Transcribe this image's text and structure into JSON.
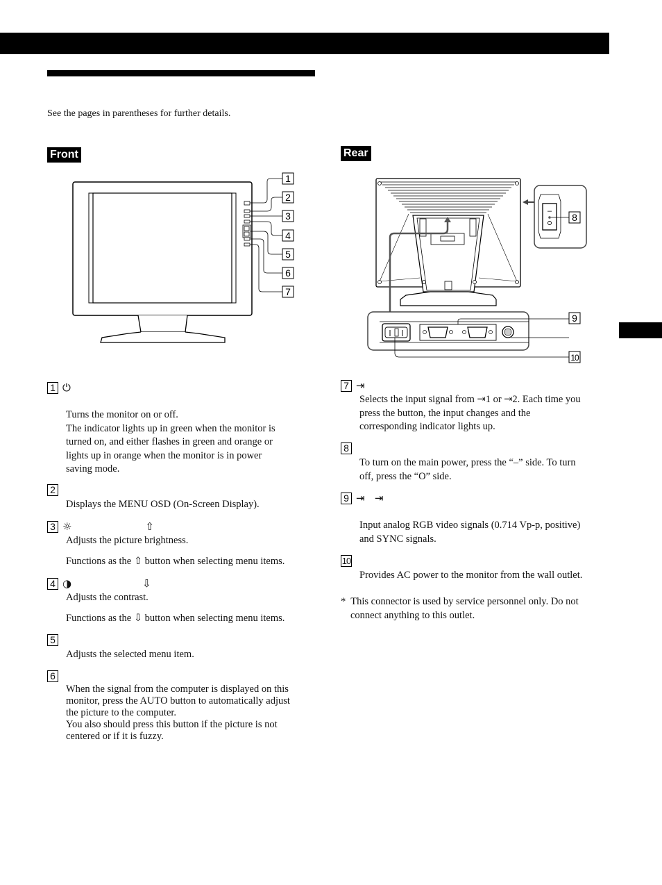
{
  "page": {
    "intro": "See the pages in parentheses for further details.",
    "front_label": "Front",
    "rear_label": "Rear"
  },
  "front_callouts": [
    "1",
    "2",
    "3",
    "4",
    "5",
    "6",
    "7"
  ],
  "rear_callouts": [
    "8",
    "9",
    "10"
  ],
  "switch_marks": {
    "on": "–",
    "off": "O"
  },
  "front_items": [
    {
      "num": "1",
      "icon": "power-icon",
      "glyph": "⏻",
      "arrow": "",
      "text": [
        "Turns the monitor on or off.",
        "The indicator lights up in green when the monitor is",
        "turned on, and either flashes in green and orange or",
        "lights up in orange when the monitor is in power",
        "saving mode."
      ]
    },
    {
      "num": "2",
      "icon": "",
      "glyph": "",
      "arrow": "",
      "text": [
        "Displays the MENU OSD (On-Screen Display)."
      ]
    },
    {
      "num": "3",
      "icon": "brightness-icon",
      "glyph": "☼",
      "arrow": "⇧",
      "text": [
        "Adjusts the picture brightness."
      ],
      "note": "Functions as the ⇧ button when selecting menu items."
    },
    {
      "num": "4",
      "icon": "contrast-icon",
      "glyph": "◑",
      "arrow": "⇩",
      "text": [
        "Adjusts the contrast."
      ],
      "note": "Functions as the ⇩ button when selecting menu items."
    },
    {
      "num": "5",
      "icon": "",
      "glyph": "",
      "arrow": "",
      "text": [
        "Adjusts the selected menu item."
      ]
    },
    {
      "num": "6",
      "icon": "",
      "glyph": "",
      "arrow": "",
      "text": [
        "When the signal from the computer is displayed on this",
        "monitor, press the AUTO button to automatically adjust",
        "the picture to the computer.",
        "You also should press this button if the picture is not",
        "centered or if it is fuzzy."
      ]
    }
  ],
  "rear_items": [
    {
      "num": "7",
      "icon": "input-icon",
      "glyph": "⇥",
      "text": [
        "Selects the input signal from ⇥1 or ⇥2. Each time you",
        "press the button, the input changes and the",
        "corresponding indicator lights up."
      ]
    },
    {
      "num": "8",
      "icon": "",
      "glyph": "",
      "text": [
        "To turn on the main power, press the “–” side. To turn",
        "off, press the “O” side."
      ]
    },
    {
      "num": "9",
      "icon": "input-icon",
      "glyph": "⇥   ⇥",
      "text": [
        "Input analog RGB video signals (0.714 Vp-p, positive)",
        "and SYNC signals."
      ]
    },
    {
      "num": "10",
      "icon": "",
      "glyph": "",
      "text": [
        "Provides AC power to the monitor from the wall outlet."
      ]
    }
  ],
  "footnote": [
    "*  This connector is used by service personnel only. Do not",
    "connect anything to this outlet."
  ]
}
